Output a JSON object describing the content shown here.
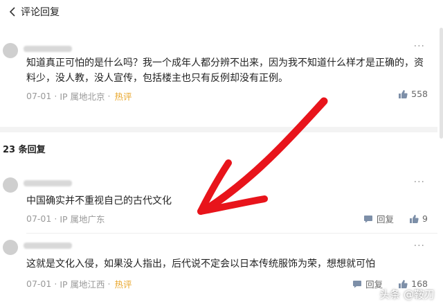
{
  "header": {
    "title": "评论回复"
  },
  "main_comment": {
    "text": "知道真正可怕的是什么吗？我一个成年人都分辨不出来，因为我不知道什么样才是正确的，资料少，没人教，没人宣传，包括楼主也只有反例却没有正例。",
    "date": "07-01",
    "ip": "IP 属地北京",
    "hot": "热评",
    "likes": "558"
  },
  "reply_count_label": "23 条回复",
  "replies": [
    {
      "text": "中国确实并不重视自己的古代文化",
      "date": "07-01",
      "ip": "IP 属地广东",
      "reply_label": "回复",
      "likes": "9"
    },
    {
      "text": "这就是文化入侵，如果没人指出，后代说不定会以日本传统服饰为荣，想想就可怕",
      "date": "07-01",
      "ip": "IP 属地江西",
      "hot": "热评",
      "reply_label": "回复",
      "likes": "168"
    }
  ],
  "watermark": "头条 @鞍刃",
  "colors": {
    "annotation_arrow": "#e8141b",
    "hot": "#e9a62a"
  }
}
